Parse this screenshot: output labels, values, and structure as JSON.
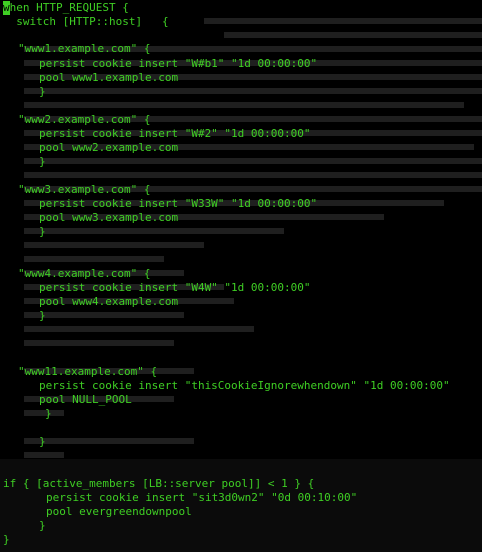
{
  "terminal": {
    "cursor_char": "w",
    "colors": {
      "background": "#000000",
      "text": "#3fcf24",
      "ghost_text": "#262626",
      "cursor": "#3fcf24"
    },
    "lines": [
      "hen HTTP_REQUEST {",
      "  switch [HTTP::host]   {",
      "\"www1.example.com\" {",
      "persist cookie insert \"W#b1\" \"1d 00:00:00\"",
      "pool www1.example.com",
      "}",
      "\"www2.example.com\" {",
      "persist cookie insert \"W#2\" \"1d 00:00:00\"",
      "pool www2.example.com",
      "}",
      "\"www3.example.com\" {",
      "persist cookie insert \"W33W\" \"1d 00:00:00\"",
      "pool www3.example.com",
      "}",
      "\"www4.example.com\" {",
      "persist cookie insert \"W4W\" \"1d 00:00:00\"",
      "pool www4.example.com",
      "}",
      "\"www11.example.com\" {",
      "persist cookie insert \"thisCookieIgnorewhendown\" \"1d 00:00:00\"",
      "pool NULL_POOL",
      "}",
      "}",
      "if { [active_members [LB::server pool]] < 1 } {",
      "persist cookie insert \"sit3d0wn2\" \"0d 00:10:00\"",
      "pool evergreendownpool",
      "}",
      "}"
    ]
  }
}
